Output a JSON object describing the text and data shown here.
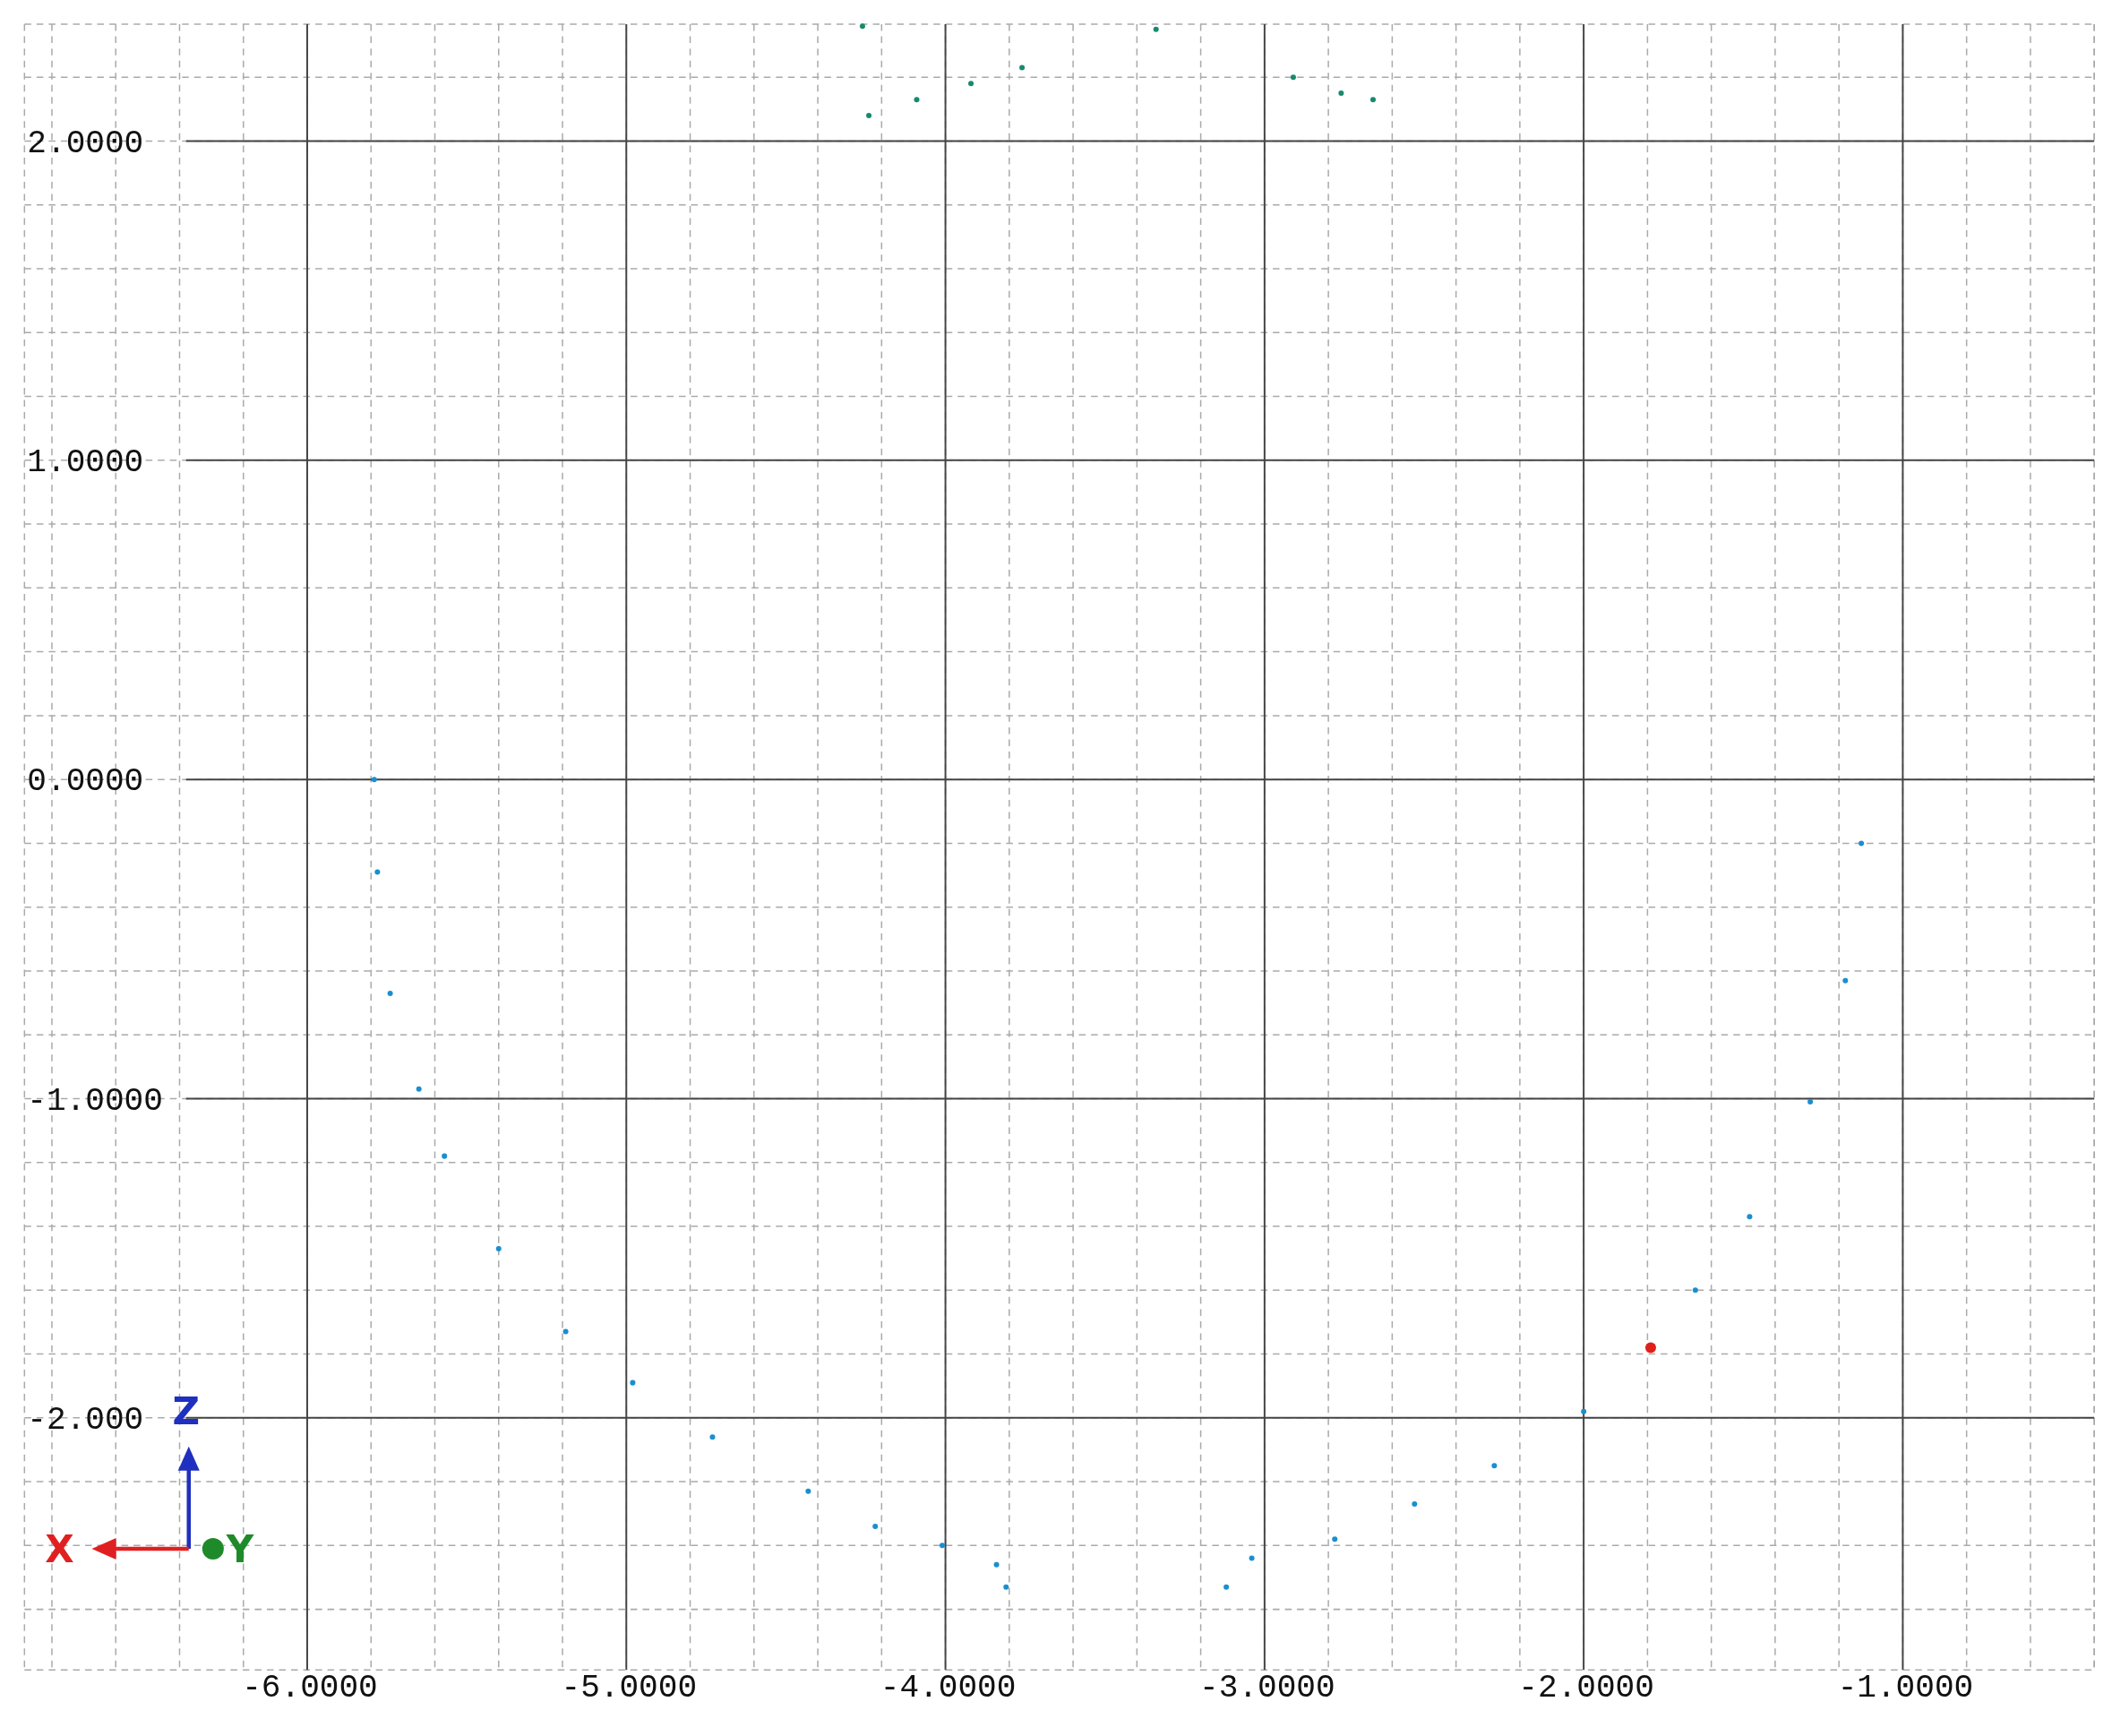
{
  "viewport": {
    "chart_data": {
      "type": "scatter",
      "grid": true,
      "xlim": [
        -6.886,
        -0.4
      ],
      "ylim": [
        -2.79,
        2.366
      ],
      "xticks": [
        {
          "value": -6,
          "label": "-6.0000"
        },
        {
          "value": -5,
          "label": "-5.0000"
        },
        {
          "value": -4,
          "label": "-4.0000"
        },
        {
          "value": -3,
          "label": "-3.0000"
        },
        {
          "value": -2,
          "label": "-2.0000"
        },
        {
          "value": -1,
          "label": "-1.0000"
        }
      ],
      "yticks": [
        {
          "value": 2,
          "label": "2.0000"
        },
        {
          "value": 1,
          "label": "1.0000"
        },
        {
          "value": 0,
          "label": "0.0000"
        },
        {
          "value": -1,
          "label": "-1.0000"
        },
        {
          "value": -2,
          "label": "-2.000"
        }
      ],
      "series": [
        {
          "color": "#1a8fd0",
          "x": [
            -5.79,
            -5.78,
            -5.74,
            -5.65,
            -5.57,
            -5.4,
            -5.19,
            -4.98,
            -4.73,
            -4.43,
            -4.22,
            -4.01,
            -3.84,
            -3.81,
            -3.12,
            -3.04,
            -2.78,
            -2.53,
            -2.28,
            -2.0,
            -1.65,
            -1.48,
            -1.29,
            -1.18,
            -1.13
          ],
          "values": [
            0.0,
            -0.29,
            -0.67,
            -0.97,
            -1.18,
            -1.47,
            -1.73,
            -1.89,
            -2.06,
            -2.23,
            -2.34,
            -2.4,
            -2.46,
            -2.53,
            -2.53,
            -2.44,
            -2.38,
            -2.27,
            -2.15,
            -1.98,
            -1.6,
            -1.37,
            -1.01,
            -0.63,
            -0.2
          ]
        },
        {
          "color": "#178a6e",
          "x": [
            -4.24,
            -4.09,
            -3.92,
            -3.76,
            -2.91,
            -2.76,
            -2.66,
            -4.26,
            -3.34
          ],
          "values": [
            2.08,
            2.13,
            2.18,
            2.23,
            2.2,
            2.15,
            2.13,
            2.36,
            2.35
          ]
        },
        {
          "color": "#e0201b",
          "x": [
            -1.79
          ],
          "values": [
            -1.78
          ]
        }
      ]
    }
  },
  "axis_gizmo": {
    "labels": [
      {
        "kind": "z",
        "text": "Z",
        "color": "#1f2fbf"
      },
      {
        "kind": "x",
        "text": "X",
        "color": "#e02020"
      },
      {
        "kind": "y",
        "text": "Y",
        "color": "#1f8a2a"
      }
    ]
  }
}
